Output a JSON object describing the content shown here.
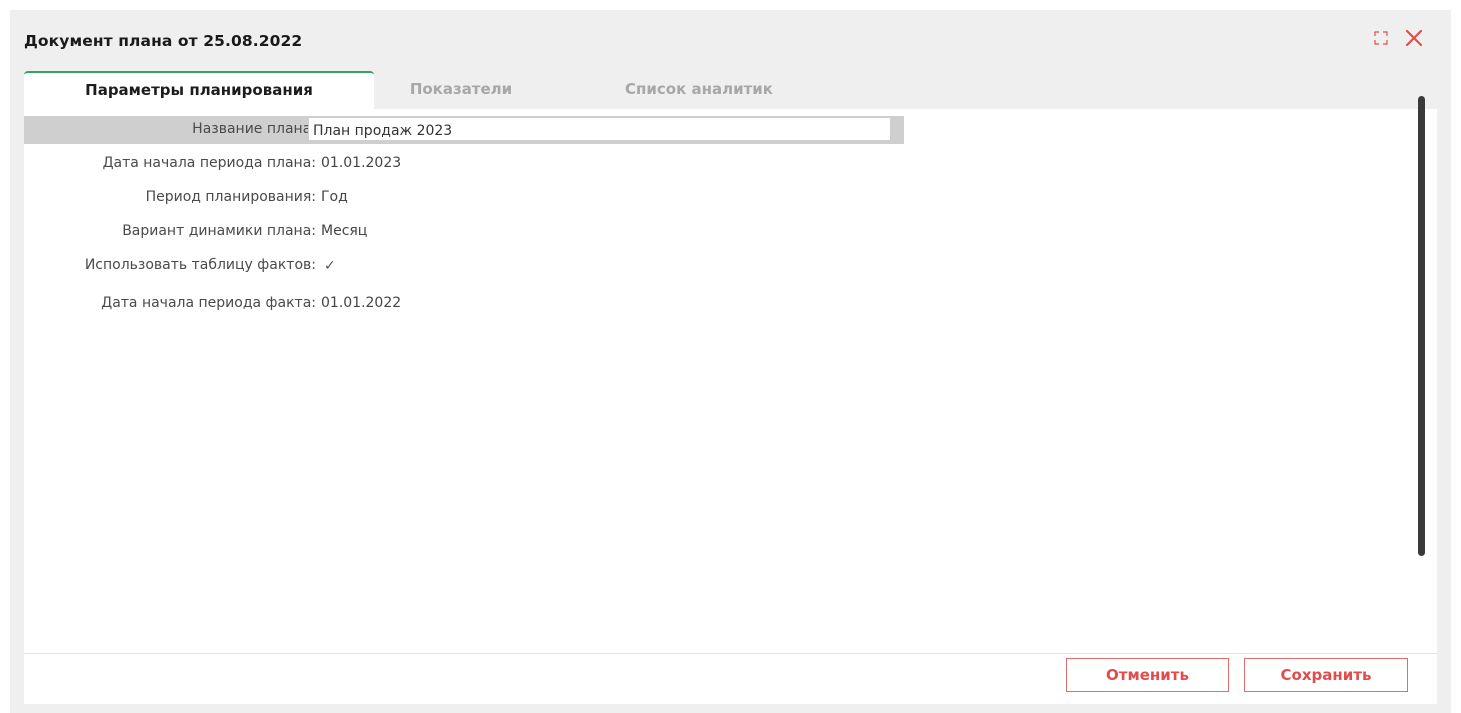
{
  "window": {
    "title": "Документ плана от 25.08.2022",
    "maximize_icon": "expand-arrows-icon",
    "close_icon": "close-x-icon",
    "accent_color": "#e24c4c",
    "active_tab_color": "#3aa35a"
  },
  "tabs": [
    {
      "label": "Параметры планирования",
      "active": true
    },
    {
      "label": "Показатели",
      "active": false
    },
    {
      "label": "Список аналитик",
      "active": false
    }
  ],
  "form": {
    "plan_name": {
      "label": "Название плана:",
      "value": "План продаж 2023"
    },
    "plan_start_date": {
      "label": "Дата начала периода плана:",
      "value": "01.01.2023"
    },
    "planning_period": {
      "label": "Период планирования:",
      "value": "Год"
    },
    "dynamics_variant": {
      "label": "Вариант динамики плана:",
      "value": "Месяц"
    },
    "use_facts_table": {
      "label": "Использовать таблицу фактов:",
      "value": "✓"
    },
    "fact_start_date": {
      "label": "Дата начала периода факта:",
      "value": "01.01.2022"
    }
  },
  "footer": {
    "cancel_label": "Отменить",
    "save_label": "Сохранить"
  }
}
